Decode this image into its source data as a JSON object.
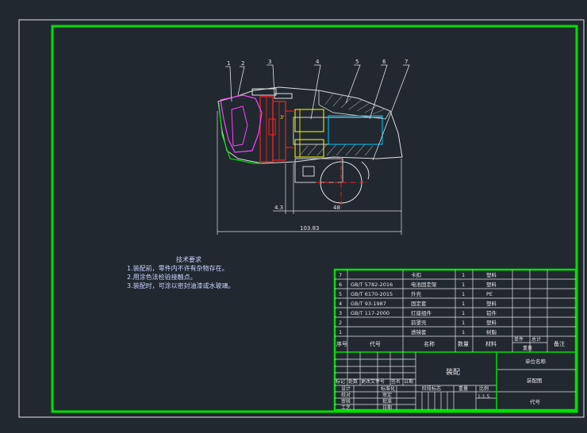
{
  "balloons": [
    "1",
    "2",
    "3",
    "4",
    "5",
    "6",
    "7"
  ],
  "dimensions": {
    "d1": "4.3",
    "d2": "48",
    "d3": "103.83"
  },
  "tech_requirements": {
    "title": "技术要求",
    "items": [
      "1.装配前，零件内不许有杂物存在。",
      "2.用涂色法检验接触点。",
      "3.装配时，可涂以密封油漆或水玻璃。"
    ]
  },
  "bom": {
    "rows": [
      {
        "no": "7",
        "code": "",
        "name": "卡扣",
        "qty": "1",
        "mat": "塑料"
      },
      {
        "no": "6",
        "code": "GB/T 5782-2016",
        "name": "电池固定架",
        "qty": "1",
        "mat": "塑料"
      },
      {
        "no": "5",
        "code": "GB/T 6170-2015",
        "name": "外壳",
        "qty": "1",
        "mat": "PE"
      },
      {
        "no": "4",
        "code": "GB/T 93-1987",
        "name": "固定套",
        "qty": "1",
        "mat": "塑料"
      },
      {
        "no": "3",
        "code": "GB/T 117-2000",
        "name": "灯座组件",
        "qty": "1",
        "mat": "铝件"
      },
      {
        "no": "2",
        "code": "",
        "name": "前罩壳",
        "qty": "1",
        "mat": "塑料"
      },
      {
        "no": "1",
        "code": "",
        "name": "透镜套",
        "qty": "1",
        "mat": "树脂"
      }
    ],
    "header": {
      "no": "序号",
      "code": "代号",
      "name": "名称",
      "qty": "数量",
      "mat": "材料",
      "unit": "单件",
      "total": "总计",
      "weight": "重量",
      "remark": "备注"
    }
  },
  "title_block": {
    "assembly_name": "装配",
    "unit_name": "单位名称",
    "drawing_name": "装配图",
    "code_label": "代号",
    "mark_row": [
      "标记",
      "处数",
      "更改文件号",
      "签名",
      "日期"
    ],
    "design": "设计",
    "std": "标准化",
    "check": "校对",
    "review": "审定",
    "audit": "审核",
    "approve": "批准",
    "craft": "工艺",
    "date": "日期",
    "stage": "阶段标志",
    "weight": "重量",
    "scale": "比例",
    "scale_val": "1:1.5"
  }
}
